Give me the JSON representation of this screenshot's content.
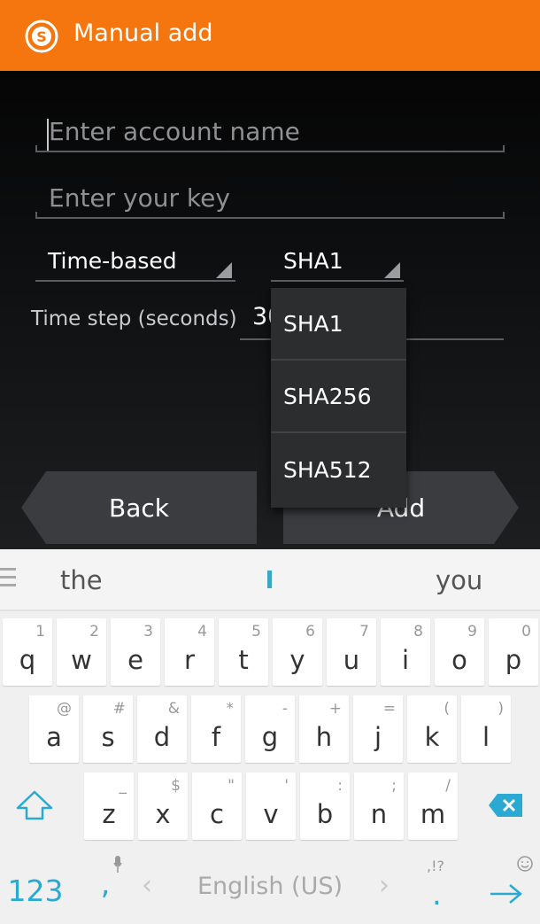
{
  "app": {
    "title": "Manual add"
  },
  "form": {
    "account_placeholder": "Enter account name",
    "key_placeholder": "Enter your key",
    "type_value": "Time-based",
    "algo_value": "SHA1",
    "timestep_label": "Time step (seconds)",
    "timestep_value": "30"
  },
  "dropdown": {
    "options": [
      "SHA1",
      "SHA256",
      "SHA512"
    ]
  },
  "buttons": {
    "back": "Back",
    "add": "Add"
  },
  "keyboard": {
    "suggestions": [
      "the",
      "I",
      "you"
    ],
    "row1": [
      {
        "k": "q",
        "s": "1"
      },
      {
        "k": "w",
        "s": "2"
      },
      {
        "k": "e",
        "s": "3"
      },
      {
        "k": "r",
        "s": "4"
      },
      {
        "k": "t",
        "s": "5"
      },
      {
        "k": "y",
        "s": "6"
      },
      {
        "k": "u",
        "s": "7"
      },
      {
        "k": "i",
        "s": "8"
      },
      {
        "k": "o",
        "s": "9"
      },
      {
        "k": "p",
        "s": "0"
      }
    ],
    "row2": [
      {
        "k": "a",
        "s": "@"
      },
      {
        "k": "s",
        "s": "#"
      },
      {
        "k": "d",
        "s": "&"
      },
      {
        "k": "f",
        "s": "*"
      },
      {
        "k": "g",
        "s": "-"
      },
      {
        "k": "h",
        "s": "+"
      },
      {
        "k": "j",
        "s": "="
      },
      {
        "k": "k",
        "s": "("
      },
      {
        "k": "l",
        "s": ")"
      }
    ],
    "row3": [
      {
        "k": "z",
        "s": "_"
      },
      {
        "k": "x",
        "s": "$"
      },
      {
        "k": "c",
        "s": "\""
      },
      {
        "k": "v",
        "s": "'"
      },
      {
        "k": "b",
        "s": ":"
      },
      {
        "k": "n",
        "s": ";"
      },
      {
        "k": "m",
        "s": "/"
      }
    ],
    "symbols_label": "123",
    "comma": ",",
    "space_label": "English (US)",
    "period": ".",
    "period_hint": ",!?",
    "accent_color": "#2aa9d2"
  },
  "colors": {
    "actionbar": "#f5760e"
  }
}
